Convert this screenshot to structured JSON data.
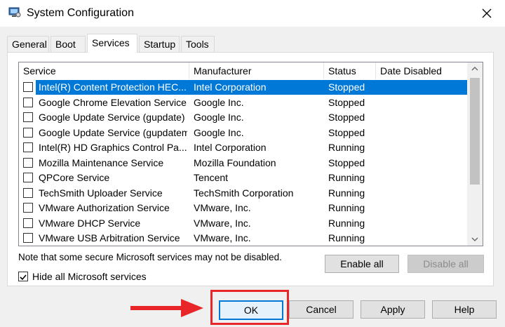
{
  "window": {
    "title": "System Configuration"
  },
  "tabs": [
    {
      "label": "General",
      "active": false
    },
    {
      "label": "Boot",
      "active": false
    },
    {
      "label": "Services",
      "active": true
    },
    {
      "label": "Startup",
      "active": false
    },
    {
      "label": "Tools",
      "active": false
    }
  ],
  "services_table": {
    "columns": [
      "Service",
      "Manufacturer",
      "Status",
      "Date Disabled"
    ],
    "rows": [
      {
        "service": "Intel(R) Content Protection HEC...",
        "manufacturer": "Intel Corporation",
        "status": "Stopped",
        "date_disabled": "",
        "checked": false,
        "selected": true
      },
      {
        "service": "Google Chrome Elevation Service",
        "manufacturer": "Google Inc.",
        "status": "Stopped",
        "date_disabled": "",
        "checked": false,
        "selected": false
      },
      {
        "service": "Google Update Service (gupdate)",
        "manufacturer": "Google Inc.",
        "status": "Stopped",
        "date_disabled": "",
        "checked": false,
        "selected": false
      },
      {
        "service": "Google Update Service (gupdatem)",
        "manufacturer": "Google Inc.",
        "status": "Stopped",
        "date_disabled": "",
        "checked": false,
        "selected": false
      },
      {
        "service": "Intel(R) HD Graphics Control Pa...",
        "manufacturer": "Intel Corporation",
        "status": "Running",
        "date_disabled": "",
        "checked": false,
        "selected": false
      },
      {
        "service": "Mozilla Maintenance Service",
        "manufacturer": "Mozilla Foundation",
        "status": "Stopped",
        "date_disabled": "",
        "checked": false,
        "selected": false
      },
      {
        "service": "QPCore Service",
        "manufacturer": "Tencent",
        "status": "Running",
        "date_disabled": "",
        "checked": false,
        "selected": false
      },
      {
        "service": "TechSmith Uploader Service",
        "manufacturer": "TechSmith Corporation",
        "status": "Running",
        "date_disabled": "",
        "checked": false,
        "selected": false
      },
      {
        "service": "VMware Authorization Service",
        "manufacturer": "VMware, Inc.",
        "status": "Running",
        "date_disabled": "",
        "checked": false,
        "selected": false
      },
      {
        "service": "VMware DHCP Service",
        "manufacturer": "VMware, Inc.",
        "status": "Running",
        "date_disabled": "",
        "checked": false,
        "selected": false
      },
      {
        "service": "VMware USB Arbitration Service",
        "manufacturer": "VMware, Inc.",
        "status": "Running",
        "date_disabled": "",
        "checked": false,
        "selected": false
      }
    ]
  },
  "note": "Note that some secure Microsoft services may not be disabled.",
  "buttons": {
    "enable_all": "Enable all",
    "disable_all": "Disable all",
    "ok": "OK",
    "cancel": "Cancel",
    "apply": "Apply",
    "help": "Help"
  },
  "hide_microsoft": {
    "label": "Hide all Microsoft services",
    "checked": true
  },
  "colors": {
    "selection": "#0078d7",
    "annotation": "#e8262a",
    "dialog_bg": "#f0f0f0"
  },
  "icons": {
    "app": "msconfig-icon",
    "close": "close-icon",
    "scroll_up": "chevron-up-icon",
    "scroll_down": "chevron-down-icon",
    "annotation_arrow": "arrow-right-icon"
  }
}
